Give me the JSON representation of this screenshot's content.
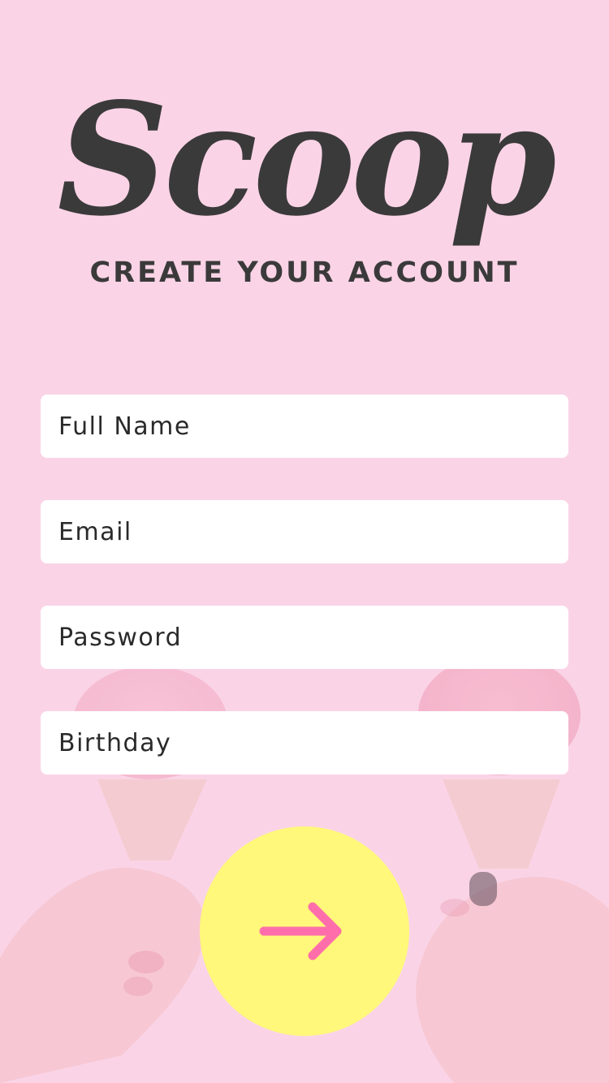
{
  "app": {
    "logo_text": "Scoop",
    "headline": "CREATE YOUR ACCOUNT"
  },
  "form": {
    "fields": [
      {
        "placeholder": "Full Name",
        "value": ""
      },
      {
        "placeholder": "Email",
        "value": ""
      },
      {
        "placeholder": "Password",
        "value": ""
      },
      {
        "placeholder": "Birthday",
        "value": ""
      }
    ],
    "submit_icon": "arrow-right-icon"
  },
  "colors": {
    "background": "#fad4e6",
    "text": "#3b3a3b",
    "submit_fill": "#fff87a",
    "arrow": "#ff6eaa"
  }
}
